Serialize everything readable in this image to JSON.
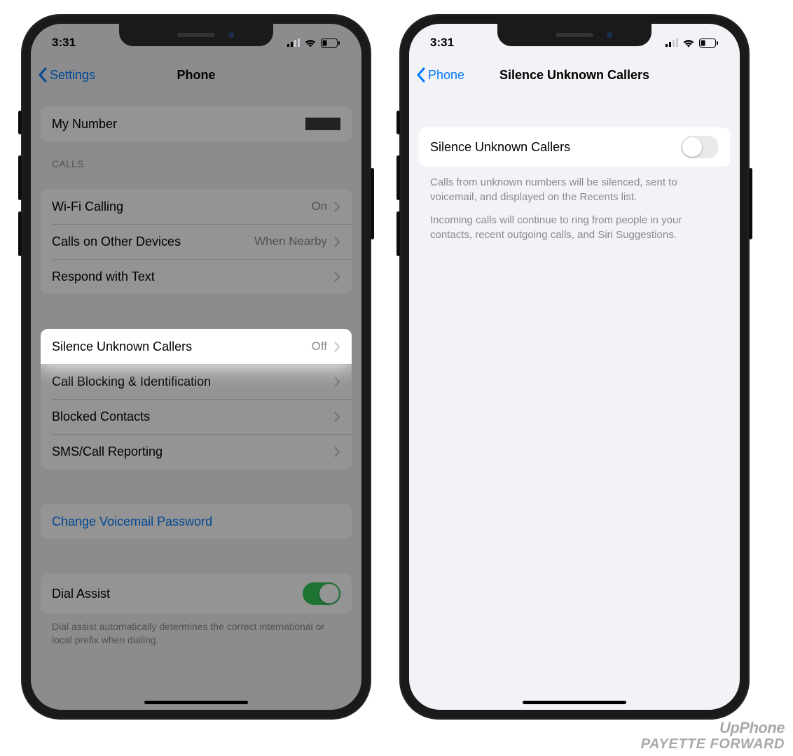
{
  "status": {
    "time": "3:31"
  },
  "left": {
    "back": "Settings",
    "title": "Phone",
    "my_number_label": "My Number",
    "calls_header": "CALLS",
    "rows": {
      "wifi_calling": {
        "label": "Wi-Fi Calling",
        "value": "On"
      },
      "other_devices": {
        "label": "Calls on Other Devices",
        "value": "When Nearby"
      },
      "respond_text": {
        "label": "Respond with Text"
      },
      "silence_unknown": {
        "label": "Silence Unknown Callers",
        "value": "Off"
      },
      "call_blocking": {
        "label": "Call Blocking & Identification"
      },
      "blocked_contacts": {
        "label": "Blocked Contacts"
      },
      "sms_reporting": {
        "label": "SMS/Call Reporting"
      },
      "change_voicemail": {
        "label": "Change Voicemail Password"
      },
      "dial_assist": {
        "label": "Dial Assist"
      }
    },
    "dial_assist_footer": "Dial assist automatically determines the correct international or local prefix when dialing."
  },
  "right": {
    "back": "Phone",
    "title": "Silence Unknown Callers",
    "toggle_label": "Silence Unknown Callers",
    "desc1": "Calls from unknown numbers will be silenced, sent to voicemail, and displayed on the Recents list.",
    "desc2": "Incoming calls will continue to ring from people in your contacts, recent outgoing calls, and Siri Suggestions."
  },
  "watermark": {
    "l1": "UpPhone",
    "l2": "PAYETTE FORWARD"
  }
}
